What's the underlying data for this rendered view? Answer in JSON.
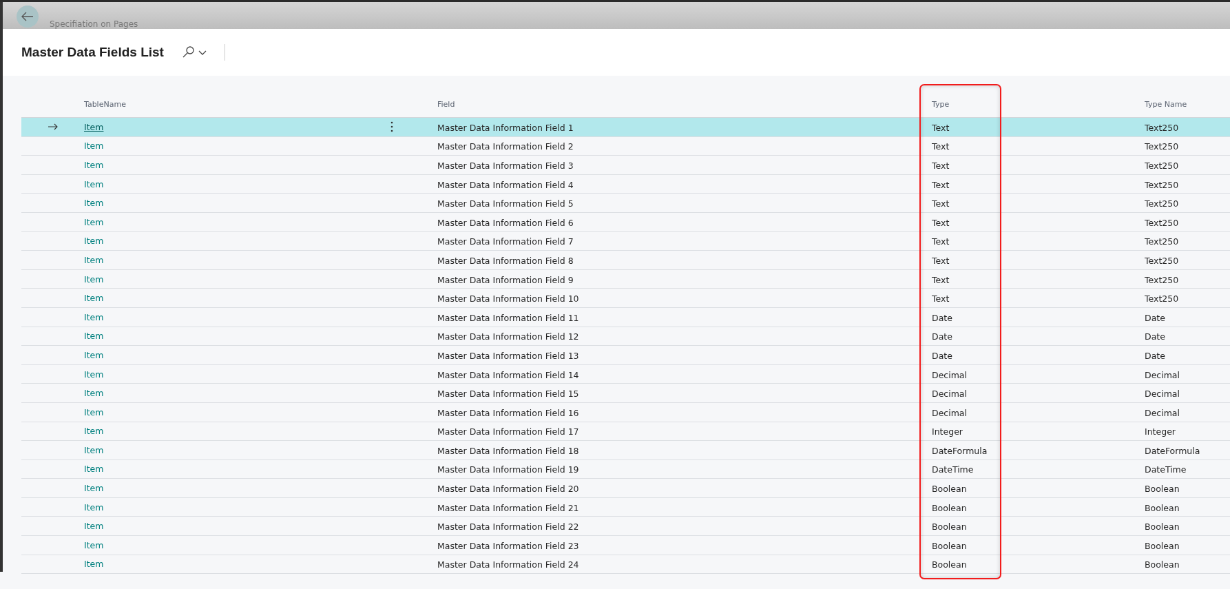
{
  "breadcrumb": "Specifiation on Pages",
  "title": "Master Data Fields List",
  "columns": [
    {
      "label": "TableName",
      "highlighted": false
    },
    {
      "label": "Field",
      "highlighted": false
    },
    {
      "label": "Type",
      "highlighted": true
    },
    {
      "label": "Type Name",
      "highlighted": false
    }
  ],
  "rows": [
    {
      "table": "Item",
      "field": "Master Data Information Field 1",
      "type": "Text",
      "type_name": "Text250",
      "selected": true
    },
    {
      "table": "Item",
      "field": "Master Data Information Field 2",
      "type": "Text",
      "type_name": "Text250",
      "selected": false
    },
    {
      "table": "Item",
      "field": "Master Data Information Field 3",
      "type": "Text",
      "type_name": "Text250",
      "selected": false
    },
    {
      "table": "Item",
      "field": "Master Data Information Field 4",
      "type": "Text",
      "type_name": "Text250",
      "selected": false
    },
    {
      "table": "Item",
      "field": "Master Data Information Field 5",
      "type": "Text",
      "type_name": "Text250",
      "selected": false
    },
    {
      "table": "Item",
      "field": "Master Data Information Field 6",
      "type": "Text",
      "type_name": "Text250",
      "selected": false
    },
    {
      "table": "Item",
      "field": "Master Data Information Field 7",
      "type": "Text",
      "type_name": "Text250",
      "selected": false
    },
    {
      "table": "Item",
      "field": "Master Data Information Field 8",
      "type": "Text",
      "type_name": "Text250",
      "selected": false
    },
    {
      "table": "Item",
      "field": "Master Data Information Field 9",
      "type": "Text",
      "type_name": "Text250",
      "selected": false
    },
    {
      "table": "Item",
      "field": "Master Data Information Field 10",
      "type": "Text",
      "type_name": "Text250",
      "selected": false
    },
    {
      "table": "Item",
      "field": "Master Data Information Field 11",
      "type": "Date",
      "type_name": "Date",
      "selected": false
    },
    {
      "table": "Item",
      "field": "Master Data Information Field 12",
      "type": "Date",
      "type_name": "Date",
      "selected": false
    },
    {
      "table": "Item",
      "field": "Master Data Information Field 13",
      "type": "Date",
      "type_name": "Date",
      "selected": false
    },
    {
      "table": "Item",
      "field": "Master Data Information Field 14",
      "type": "Decimal",
      "type_name": "Decimal",
      "selected": false
    },
    {
      "table": "Item",
      "field": "Master Data Information Field 15",
      "type": "Decimal",
      "type_name": "Decimal",
      "selected": false
    },
    {
      "table": "Item",
      "field": "Master Data Information Field 16",
      "type": "Decimal",
      "type_name": "Decimal",
      "selected": false
    },
    {
      "table": "Item",
      "field": "Master Data Information Field 17",
      "type": "Integer",
      "type_name": "Integer",
      "selected": false
    },
    {
      "table": "Item",
      "field": "Master Data Information Field 18",
      "type": "DateFormula",
      "type_name": "DateFormula",
      "selected": false
    },
    {
      "table": "Item",
      "field": "Master Data Information Field 19",
      "type": "DateTime",
      "type_name": "DateTime",
      "selected": false
    },
    {
      "table": "Item",
      "field": "Master Data Information Field 20",
      "type": "Boolean",
      "type_name": "Boolean",
      "selected": false
    },
    {
      "table": "Item",
      "field": "Master Data Information Field 21",
      "type": "Boolean",
      "type_name": "Boolean",
      "selected": false
    },
    {
      "table": "Item",
      "field": "Master Data Information Field 22",
      "type": "Boolean",
      "type_name": "Boolean",
      "selected": false
    },
    {
      "table": "Item",
      "field": "Master Data Information Field 23",
      "type": "Boolean",
      "type_name": "Boolean",
      "selected": false
    },
    {
      "table": "Item",
      "field": "Master Data Information Field 24",
      "type": "Boolean",
      "type_name": "Boolean",
      "selected": false
    }
  ]
}
